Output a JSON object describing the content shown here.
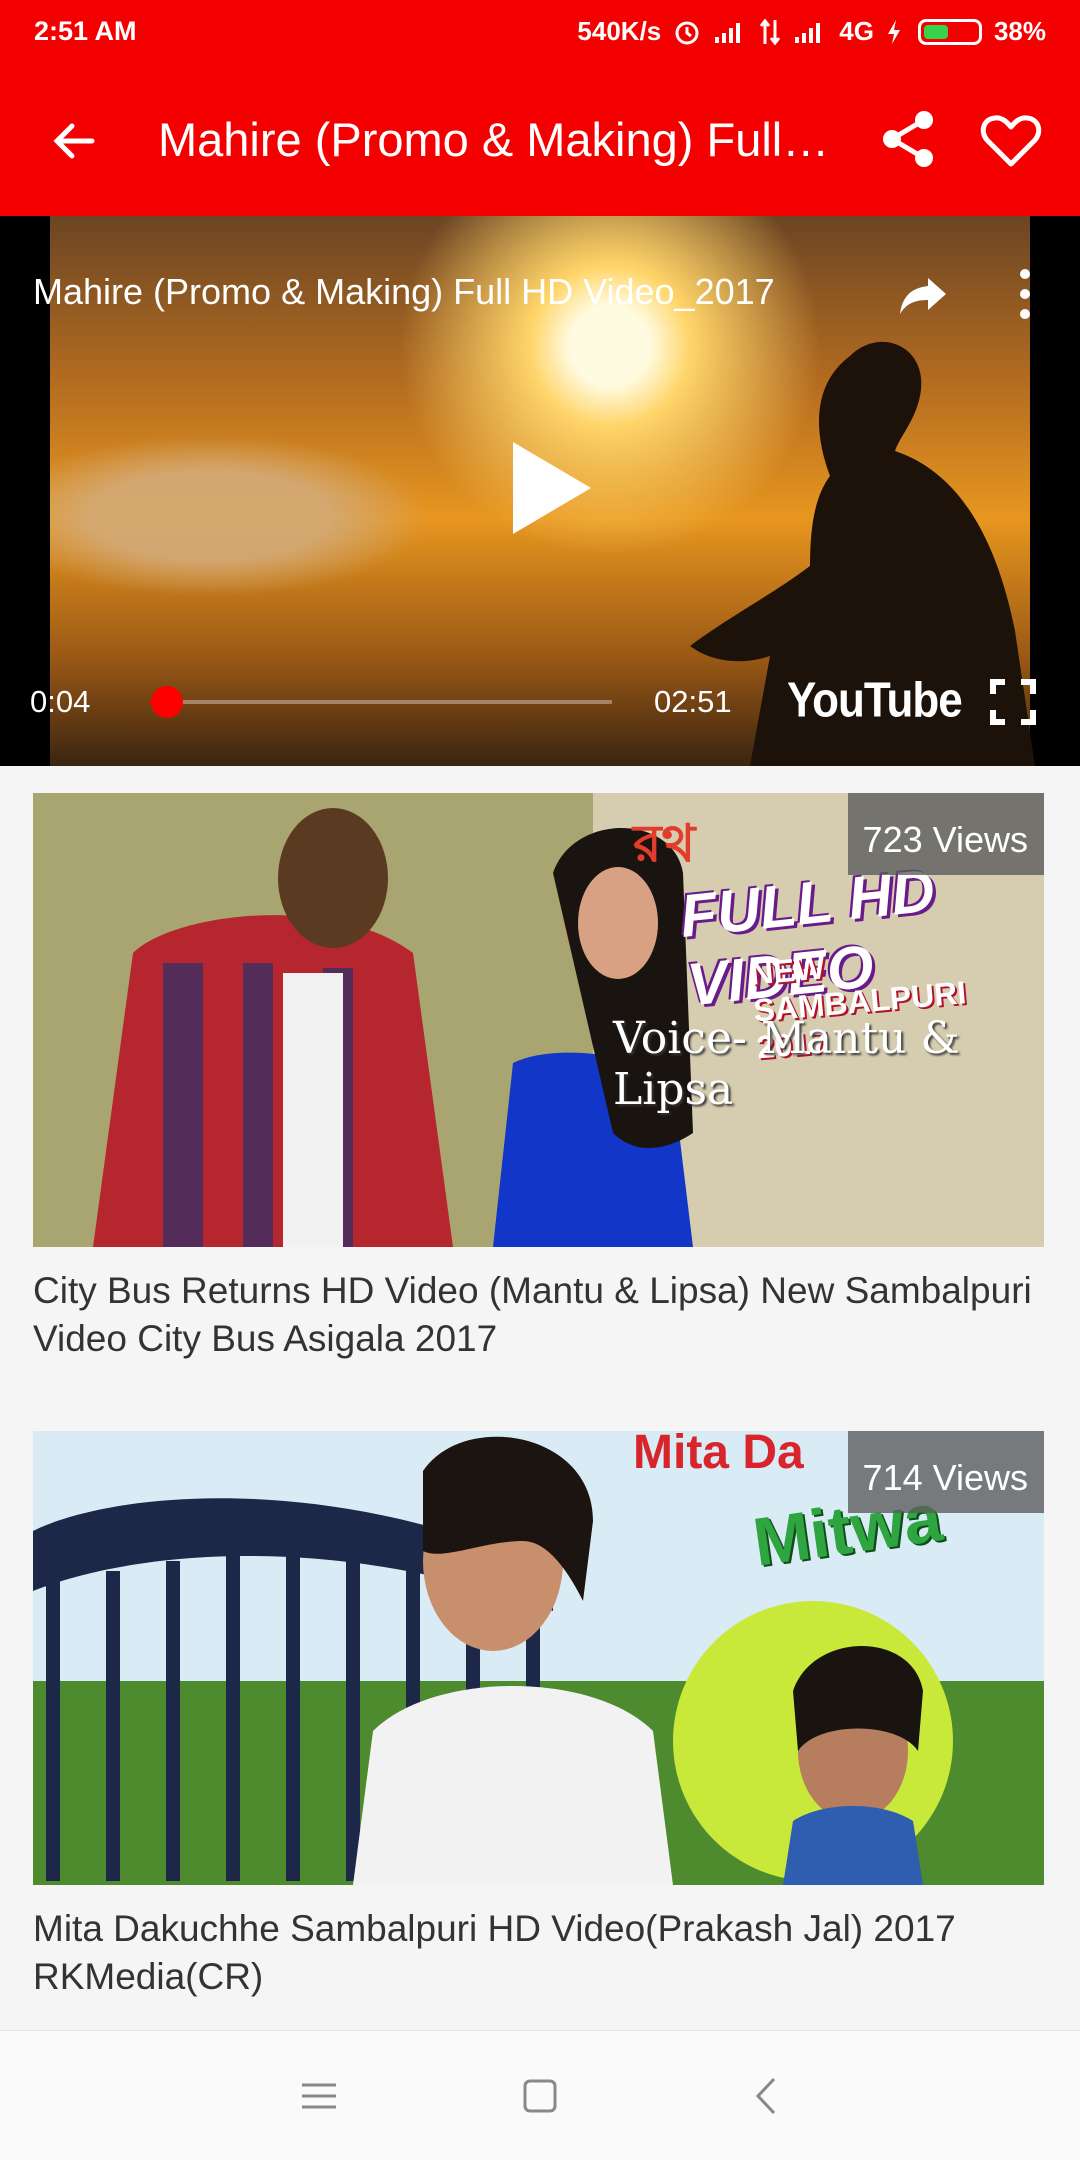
{
  "status_bar": {
    "time": "2:51 AM",
    "speed": "540K/s",
    "network": "4G",
    "battery": "38%"
  },
  "app_bar": {
    "title": "Mahire (Promo & Making) Full HD Video_2017"
  },
  "player": {
    "video_title": "Mahire (Promo & Making) Full HD Video_2017",
    "current_time": "0:04",
    "duration": "02:51",
    "progress": 0.023,
    "brand": "YouTube"
  },
  "videos": [
    {
      "views": "723 Views",
      "title": "City Bus Returns HD Video (Mantu & Lipsa) New Sambalpuri Video City Bus Asigala 2017",
      "thumb_text": [
        "FULL HD VIDEO",
        "NEW SAMBALPURI 2017",
        "Voice- Mantu & Lipsa"
      ]
    },
    {
      "views": "714 Views",
      "title": "Mita Dakuchhe Sambalpuri HD Video(Prakash Jal) 2017 RKMedia(CR)",
      "thumb_text": [
        "Mita Da",
        "Mitwa"
      ]
    }
  ],
  "colors": {
    "primary": "#f50000",
    "progress": "#ff0000"
  }
}
